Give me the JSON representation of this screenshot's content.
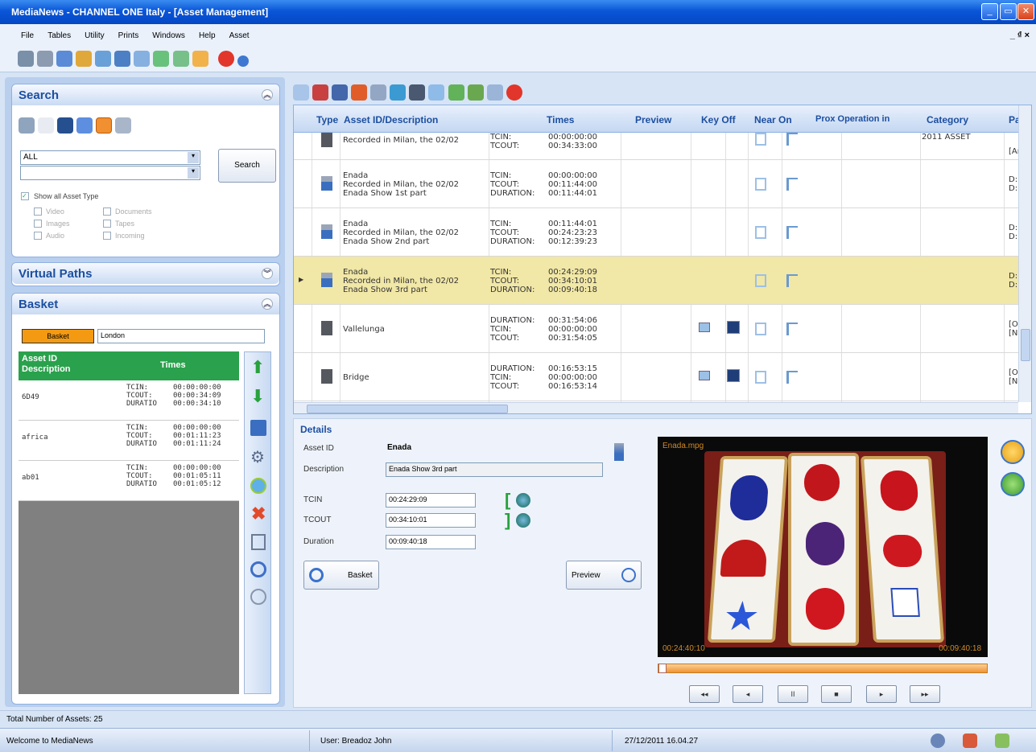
{
  "window": {
    "title": "MediaNews - CHANNEL ONE Italy - [Asset Management]",
    "controls": [
      "_",
      "▭",
      "✕"
    ]
  },
  "menu": [
    "File",
    "Tables",
    "Utility",
    "Prints",
    "Windows",
    "Help",
    "Asset"
  ],
  "mdi_controls": "_ ₫ ×",
  "search": {
    "title": "Search",
    "filter_value": "ALL",
    "second_value": "",
    "button": "Search",
    "show_all_label": "Show all Asset Type",
    "types_left": [
      "Video",
      "Images",
      "Audio"
    ],
    "types_right": [
      "Documents",
      "Tapes",
      "Incoming"
    ]
  },
  "virtual_paths": {
    "title": "Virtual Paths"
  },
  "basket": {
    "title": "Basket",
    "tag": "Basket",
    "name_value": "London",
    "col_asset": "Asset ID Description",
    "col_times": "Times",
    "items": [
      {
        "id": "6D49",
        "tcin": "00:00:00:00",
        "tcout": "00:00:34:09",
        "duration": "00:00:34:10"
      },
      {
        "id": "africa",
        "tcin": "00:00:00:00",
        "tcout": "00:01:11:23",
        "duration": "00:01:11:24"
      },
      {
        "id": "ab01",
        "tcin": "00:00:00:00",
        "tcout": "00:01:05:11",
        "duration": "00:01:05:12"
      }
    ],
    "lbl_tcin": "TCIN:",
    "lbl_tcout": "TCOUT:",
    "lbl_dur": "DURATIO"
  },
  "grid": {
    "columns": [
      "Type",
      "Asset ID/Description",
      "Times",
      "Preview",
      "Key Off",
      "Near On",
      "Prox Operation in",
      "Category",
      "Pa"
    ],
    "rows": [
      {
        "desc": [
          "Recorded in Milan, the 02/02"
        ],
        "times": [
          [
            "TCIN:",
            "00:00:00:00"
          ],
          [
            "TCOUT:",
            "00:34:33:00"
          ]
        ],
        "category": "2011 ASSET",
        "pa": [
          "[Ar"
        ]
      },
      {
        "desc": [
          "Enada",
          "Recorded in Milan, the 02/02",
          "Enada Show 1st part"
        ],
        "times": [
          [
            "TCIN:",
            "00:00:00:00"
          ],
          [
            "TCOUT:",
            "00:11:44:00"
          ],
          [
            "DURATION:",
            "00:11:44:01"
          ]
        ],
        "category": "",
        "pa": [
          "D:",
          "D:"
        ]
      },
      {
        "desc": [
          "Enada",
          "Recorded in Milan, the 02/02",
          "Enada Show 2nd part"
        ],
        "times": [
          [
            "TCIN:",
            "00:11:44:01"
          ],
          [
            "TCOUT:",
            "00:24:23:23"
          ],
          [
            "DURATION:",
            "00:12:39:23"
          ]
        ],
        "category": "",
        "pa": [
          "D:",
          "D:"
        ]
      },
      {
        "desc": [
          "Enada",
          "Recorded in Milan, the 02/02",
          "Enada Show 3rd part"
        ],
        "times": [
          [
            "TCIN:",
            "00:24:29:09"
          ],
          [
            "TCOUT:",
            "00:34:10:01"
          ],
          [
            "DURATION:",
            "00:09:40:18"
          ]
        ],
        "category": "",
        "pa": [
          "D:",
          "D:"
        ],
        "selected": true
      },
      {
        "desc": [
          "Vallelunga"
        ],
        "times": [
          [
            "DURATION:",
            "00:31:54:06"
          ],
          [
            "TCIN:",
            "00:00:00:00"
          ],
          [
            "TCOUT:",
            "00:31:54:05"
          ]
        ],
        "category": "",
        "pa": [
          "[O",
          "[N"
        ]
      },
      {
        "desc": [
          "Bridge"
        ],
        "times": [
          [
            "DURATION:",
            "00:16:53:15"
          ],
          [
            "TCIN:",
            "00:00:00:00"
          ],
          [
            "TCOUT:",
            "00:16:53:14"
          ]
        ],
        "category": "",
        "pa": [
          "[O",
          "[N"
        ]
      }
    ]
  },
  "details": {
    "title": "Details",
    "asset_id_label": "Asset ID",
    "asset_id": "Enada",
    "description_label": "Description",
    "description": "Enada Show 3rd part",
    "tcin_label": "TCIN",
    "tcin": "00:24:29:09",
    "tcout_label": "TCOUT",
    "tcout": "00:34:10:01",
    "duration_label": "Duration",
    "duration": "00:09:40:18",
    "basket_btn": "Basket",
    "preview_btn": "Preview"
  },
  "player": {
    "file": "Enada.mpg",
    "time_left": "00:24:40:10",
    "time_right": "00:09:40:18",
    "progress": 0.0,
    "buttons": [
      "◂◂",
      "◂",
      "II",
      "■",
      "▸",
      "▸▸"
    ]
  },
  "status": {
    "total": "Total Number of Assets: 25",
    "welcome": "Welcome to MediaNews",
    "user": "User: Breadoz John",
    "datetime": "27/12/2011 16.04.27"
  }
}
